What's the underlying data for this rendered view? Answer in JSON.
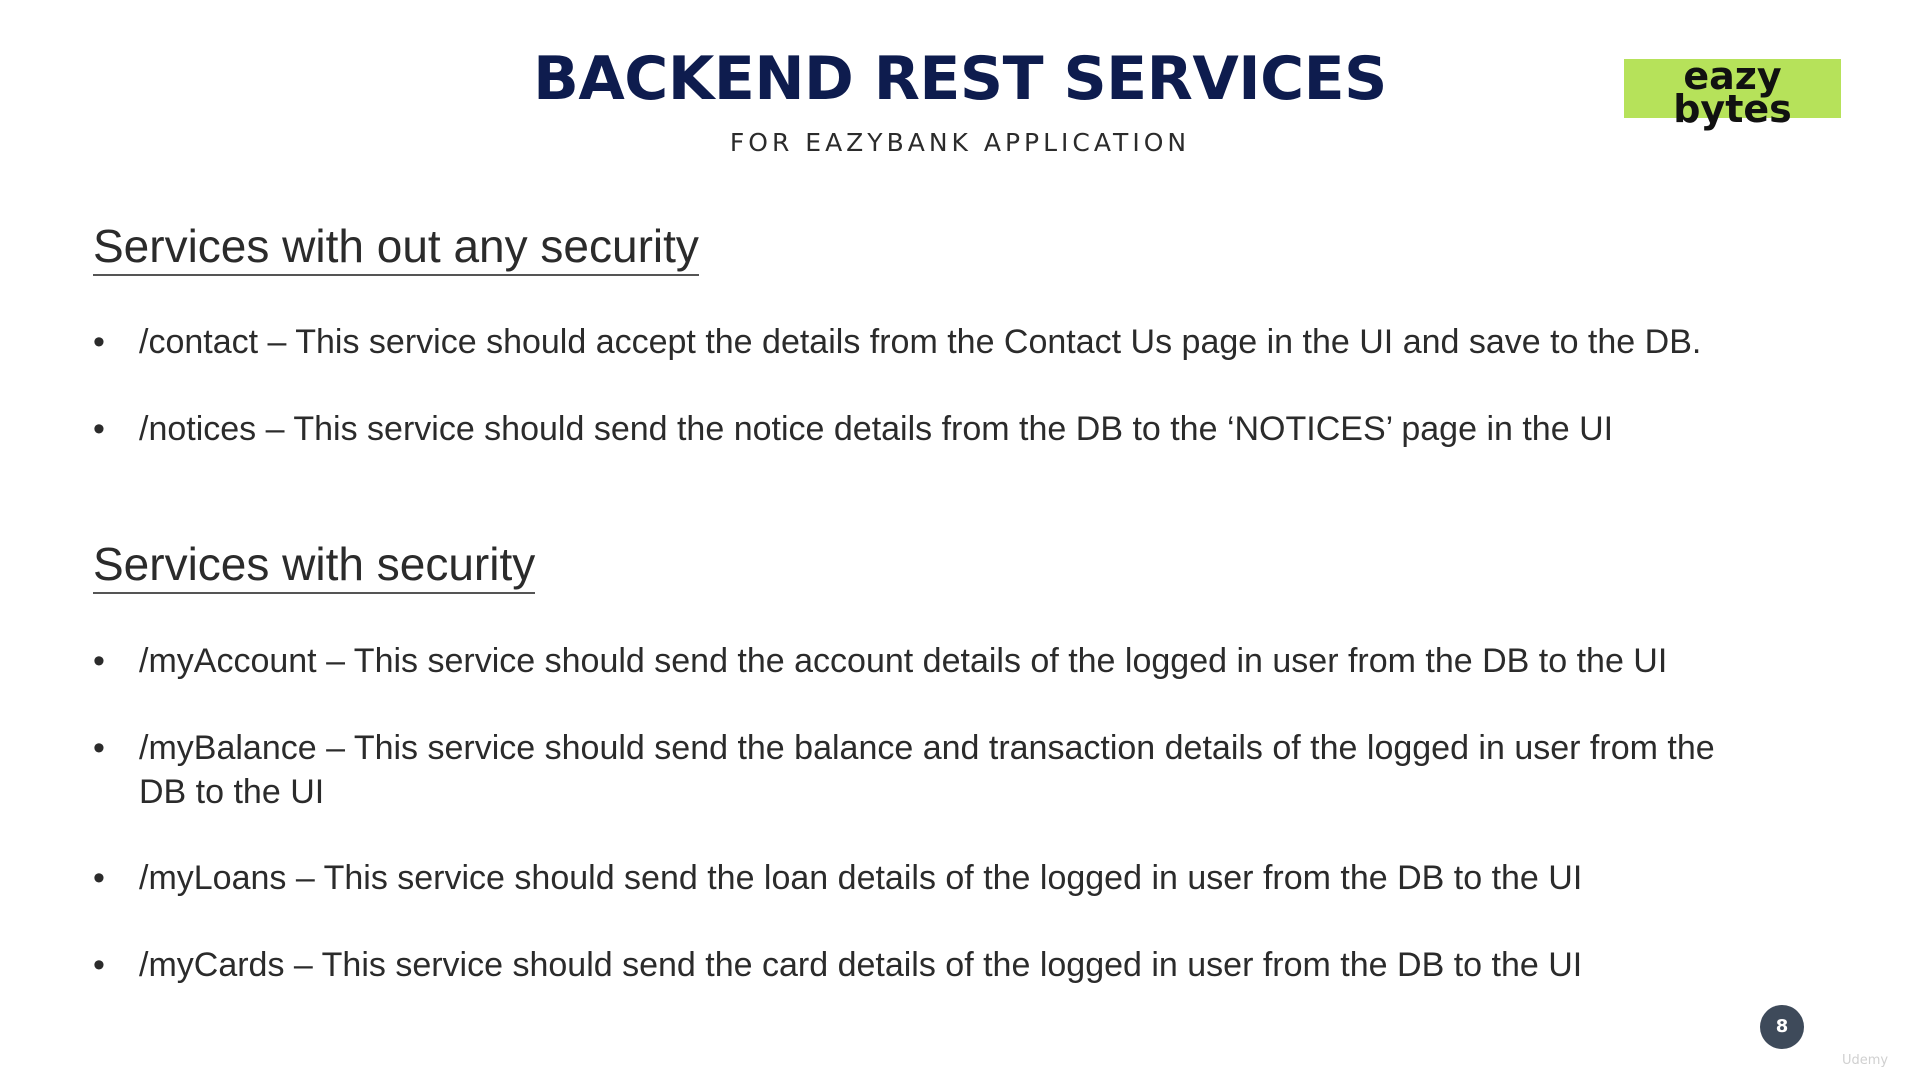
{
  "slide": {
    "title": "BACKEND REST SERVICES",
    "subtitle": "FOR EAZYBANK APPLICATION",
    "logo": {
      "line1": "eazy",
      "line2": "bytes",
      "color": "#b6e25a"
    },
    "page_number": "8",
    "watermark": "Udemy"
  },
  "sections": [
    {
      "heading": "Services with out any security",
      "items": [
        {
          "bullet": "•",
          "text": "/contact – This service should accept the details from the Contact Us page in the UI and save to the DB."
        },
        {
          "bullet": "•",
          "text": "/notices – This service should send the notice details from the DB to the ‘NOTICES’ page in the UI"
        }
      ]
    },
    {
      "heading": "Services with security",
      "items": [
        {
          "bullet": "•",
          "text": "/myAccount – This service should send the account details of the logged in user from the DB to the UI"
        },
        {
          "bullet": "•",
          "text": "/myBalance – This service should send the balance and transaction details of the logged in user from the DB to the UI"
        },
        {
          "bullet": "•",
          "text": "/myLoans – This service should send the loan details of the logged in user from the DB to the UI"
        },
        {
          "bullet": "•",
          "text": "/myCards – This service should send the card details of the logged in user from the DB to the UI"
        }
      ]
    }
  ],
  "colors": {
    "title": "#0e1c4e",
    "text": "#2b2b2b",
    "badge": "#3e4a5a"
  }
}
